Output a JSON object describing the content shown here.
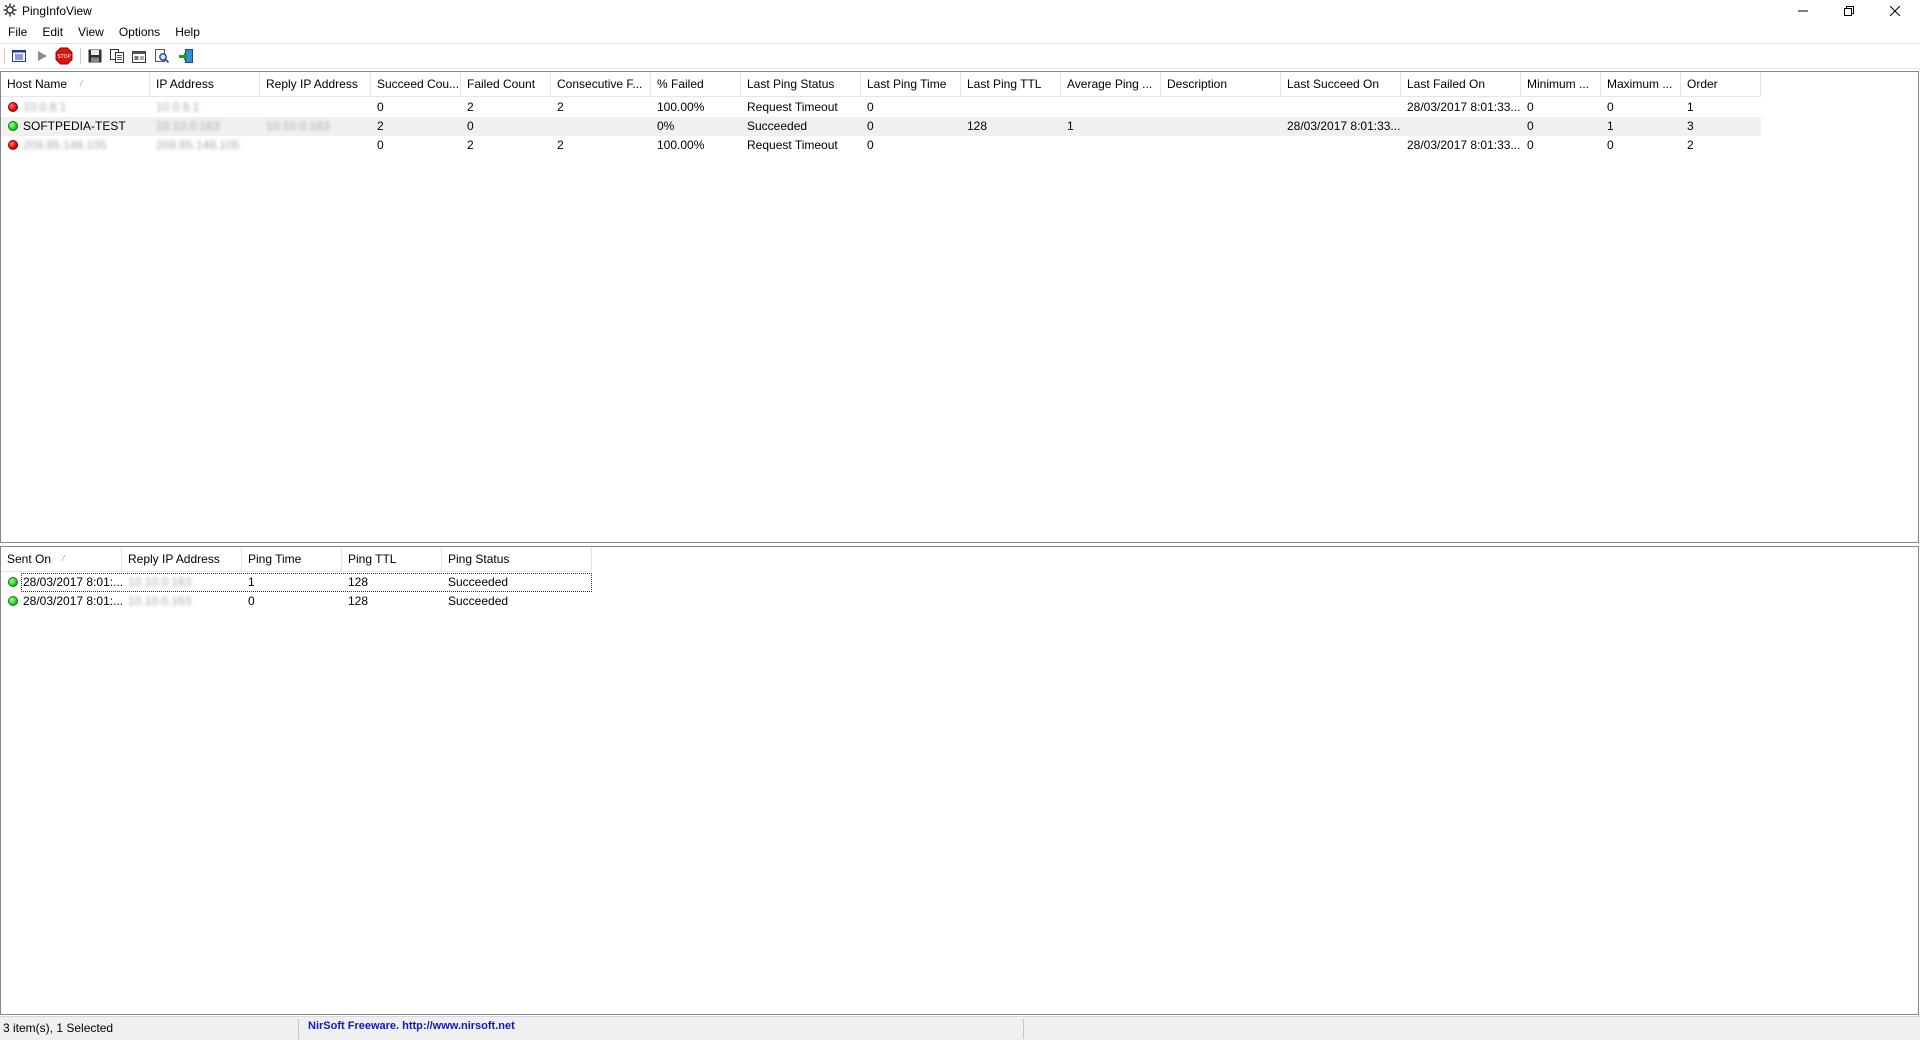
{
  "window": {
    "title": "PingInfoView"
  },
  "menu": [
    "File",
    "Edit",
    "View",
    "Options",
    "Help"
  ],
  "toolbar": {
    "buttons": [
      {
        "name": "options-list-icon"
      },
      {
        "name": "play-icon"
      },
      {
        "name": "stop-icon",
        "text": "STOP"
      },
      {
        "name": "save-icon"
      },
      {
        "name": "copy-icon"
      },
      {
        "name": "properties-icon"
      },
      {
        "name": "find-icon"
      },
      {
        "name": "exit-icon"
      }
    ]
  },
  "top_table": {
    "columns": [
      "Host Name",
      "IP Address",
      "Reply IP Address",
      "Succeed Cou...",
      "Failed Count",
      "Consecutive F...",
      "% Failed",
      "Last Ping Status",
      "Last Ping Time",
      "Last Ping TTL",
      "Average Ping ...",
      "Description",
      "Last Succeed On",
      "Last Failed On",
      "Minimum ...",
      "Maximum ...",
      "Order"
    ],
    "rows": [
      {
        "status": "red",
        "cells": [
          "10.0.8.1",
          "10.0.8.1",
          "",
          "0",
          "2",
          "2",
          "100.00%",
          "Request Timeout",
          "0",
          "",
          "",
          "",
          "",
          "28/03/2017 8:01:33...",
          "0",
          "0",
          "1"
        ]
      },
      {
        "status": "green",
        "cells": [
          "SOFTPEDIA-TEST",
          "10.10.0.163",
          "10.10.0.163",
          "2",
          "0",
          "",
          "0%",
          "Succeeded",
          "0",
          "128",
          "1",
          "",
          "28/03/2017 8:01:33...",
          "",
          "0",
          "1",
          "3"
        ]
      },
      {
        "status": "red",
        "cells": [
          "209.85.148.105",
          "209.85.148.105",
          "",
          "0",
          "2",
          "2",
          "100.00%",
          "Request Timeout",
          "0",
          "",
          "",
          "",
          "",
          "28/03/2017 8:01:33...",
          "0",
          "0",
          "2"
        ]
      }
    ]
  },
  "bottom_table": {
    "columns": [
      "Sent On",
      "Reply IP Address",
      "Ping Time",
      "Ping TTL",
      "Ping Status"
    ],
    "rows": [
      {
        "status": "green",
        "cells": [
          "28/03/2017 8:01:...",
          "10.10.0.163",
          "1",
          "128",
          "Succeeded"
        ]
      },
      {
        "status": "green",
        "cells": [
          "28/03/2017 8:01:...",
          "10.10.0.163",
          "0",
          "128",
          "Succeeded"
        ]
      }
    ]
  },
  "statusbar": {
    "items": "3 item(s), 1 Selected",
    "credit": "NirSoft Freeware.  http://www.nirsoft.net"
  },
  "colors": {
    "credit_link": "#1515c8",
    "selected_row": "#f0f0f0",
    "status_red": "#e00000",
    "status_green": "#22cc22"
  }
}
